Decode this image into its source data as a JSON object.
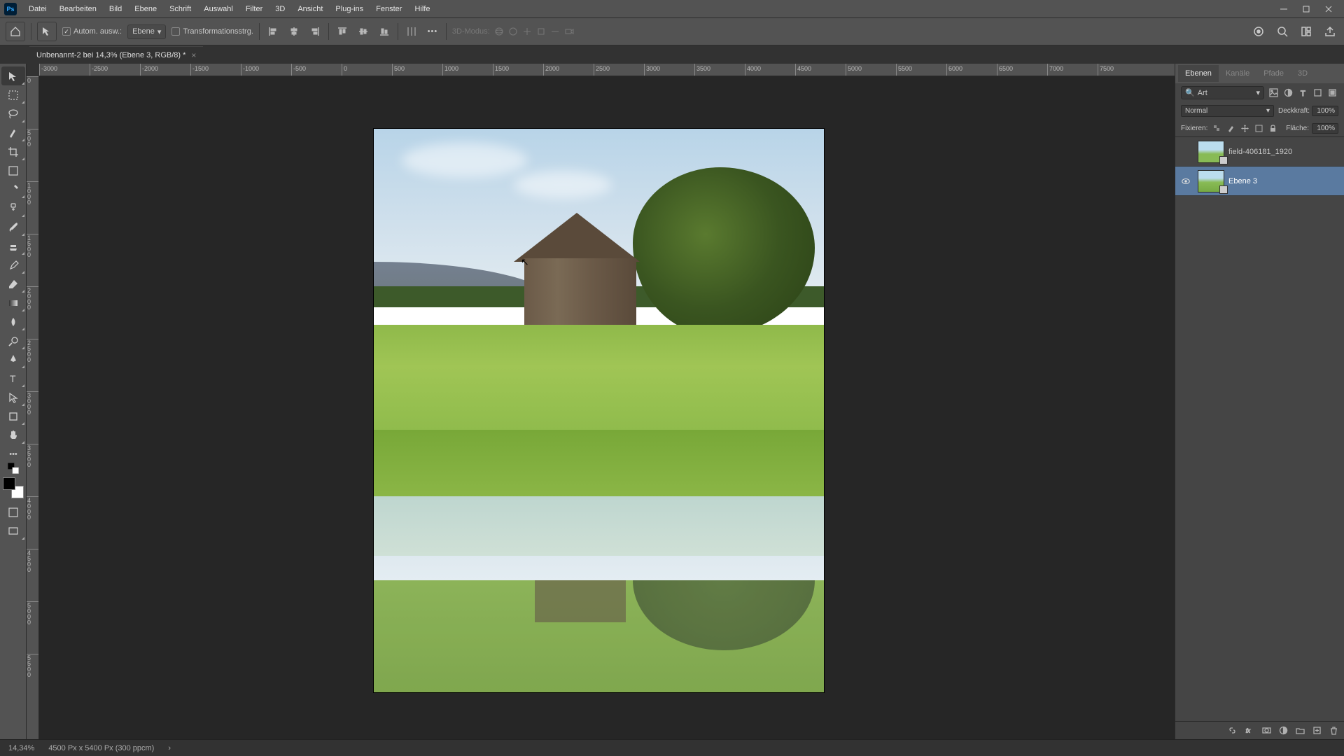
{
  "app": {
    "logo": "Ps"
  },
  "menu": [
    "Datei",
    "Bearbeiten",
    "Bild",
    "Ebene",
    "Schrift",
    "Auswahl",
    "Filter",
    "3D",
    "Ansicht",
    "Plug-ins",
    "Fenster",
    "Hilfe"
  ],
  "options": {
    "auto_select_label": "Autom. ausw.:",
    "layer_dd": "Ebene",
    "transform_controls": "Transformationsstrg.",
    "mode3d": "3D-Modus:"
  },
  "document": {
    "tab_title": "Unbenannt-2 bei 14,3% (Ebene 3, RGB/8) *"
  },
  "ruler_h": [
    "-3000",
    "-2500",
    "-2000",
    "-1500",
    "-1000",
    "-500",
    "0",
    "500",
    "1000",
    "1500",
    "2000",
    "2500",
    "3000",
    "3500",
    "4000",
    "4500",
    "5000",
    "5500",
    "6000",
    "6500",
    "7000",
    "7500"
  ],
  "ruler_v": [
    "0",
    "500",
    "1000",
    "1500",
    "2000",
    "2500",
    "3000",
    "3500",
    "4000",
    "4500",
    "5000",
    "5500"
  ],
  "panels": {
    "tabs": [
      "Ebenen",
      "Kanäle",
      "Pfade",
      "3D"
    ],
    "filter_placeholder": "Art",
    "blend_mode": "Normal",
    "opacity_label": "Deckkraft:",
    "opacity_value": "100%",
    "lock_label": "Fixieren:",
    "fill_label": "Fläche:",
    "fill_value": "100%",
    "layers": [
      {
        "name": "field-406181_1920",
        "visible": false,
        "selected": false
      },
      {
        "name": "Ebene 3",
        "visible": true,
        "selected": true
      }
    ]
  },
  "status": {
    "zoom": "14,34%",
    "dims": "4500 Px x 5400 Px (300 ppcm)"
  }
}
